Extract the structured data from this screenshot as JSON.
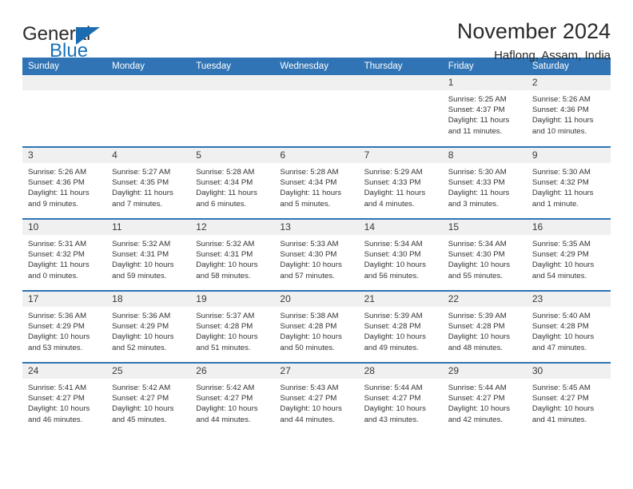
{
  "brand": {
    "name_top": "General",
    "name_bottom": "Blue",
    "color_blue": "#1b72b8",
    "triangle_icon": "triangle-icon"
  },
  "header": {
    "title": "November 2024",
    "subtitle": "Haflong, Assam, India",
    "header_bg": "#3074b5"
  },
  "calendar": {
    "weekday_headers": [
      "Sunday",
      "Monday",
      "Tuesday",
      "Wednesday",
      "Thursday",
      "Friday",
      "Saturday"
    ],
    "weeks": [
      [
        {
          "day": "",
          "blank": true,
          "sunrise": "",
          "sunset": "",
          "daylight1": "",
          "daylight2": ""
        },
        {
          "day": "",
          "blank": true,
          "sunrise": "",
          "sunset": "",
          "daylight1": "",
          "daylight2": ""
        },
        {
          "day": "",
          "blank": true,
          "sunrise": "",
          "sunset": "",
          "daylight1": "",
          "daylight2": ""
        },
        {
          "day": "",
          "blank": true,
          "sunrise": "",
          "sunset": "",
          "daylight1": "",
          "daylight2": ""
        },
        {
          "day": "",
          "blank": true,
          "sunrise": "",
          "sunset": "",
          "daylight1": "",
          "daylight2": ""
        },
        {
          "day": "1",
          "blank": false,
          "sunrise": "Sunrise: 5:25 AM",
          "sunset": "Sunset: 4:37 PM",
          "daylight1": "Daylight: 11 hours",
          "daylight2": "and 11 minutes."
        },
        {
          "day": "2",
          "blank": false,
          "sunrise": "Sunrise: 5:26 AM",
          "sunset": "Sunset: 4:36 PM",
          "daylight1": "Daylight: 11 hours",
          "daylight2": "and 10 minutes."
        }
      ],
      [
        {
          "day": "3",
          "blank": false,
          "sunrise": "Sunrise: 5:26 AM",
          "sunset": "Sunset: 4:36 PM",
          "daylight1": "Daylight: 11 hours",
          "daylight2": "and 9 minutes."
        },
        {
          "day": "4",
          "blank": false,
          "sunrise": "Sunrise: 5:27 AM",
          "sunset": "Sunset: 4:35 PM",
          "daylight1": "Daylight: 11 hours",
          "daylight2": "and 7 minutes."
        },
        {
          "day": "5",
          "blank": false,
          "sunrise": "Sunrise: 5:28 AM",
          "sunset": "Sunset: 4:34 PM",
          "daylight1": "Daylight: 11 hours",
          "daylight2": "and 6 minutes."
        },
        {
          "day": "6",
          "blank": false,
          "sunrise": "Sunrise: 5:28 AM",
          "sunset": "Sunset: 4:34 PM",
          "daylight1": "Daylight: 11 hours",
          "daylight2": "and 5 minutes."
        },
        {
          "day": "7",
          "blank": false,
          "sunrise": "Sunrise: 5:29 AM",
          "sunset": "Sunset: 4:33 PM",
          "daylight1": "Daylight: 11 hours",
          "daylight2": "and 4 minutes."
        },
        {
          "day": "8",
          "blank": false,
          "sunrise": "Sunrise: 5:30 AM",
          "sunset": "Sunset: 4:33 PM",
          "daylight1": "Daylight: 11 hours",
          "daylight2": "and 3 minutes."
        },
        {
          "day": "9",
          "blank": false,
          "sunrise": "Sunrise: 5:30 AM",
          "sunset": "Sunset: 4:32 PM",
          "daylight1": "Daylight: 11 hours",
          "daylight2": "and 1 minute."
        }
      ],
      [
        {
          "day": "10",
          "blank": false,
          "sunrise": "Sunrise: 5:31 AM",
          "sunset": "Sunset: 4:32 PM",
          "daylight1": "Daylight: 11 hours",
          "daylight2": "and 0 minutes."
        },
        {
          "day": "11",
          "blank": false,
          "sunrise": "Sunrise: 5:32 AM",
          "sunset": "Sunset: 4:31 PM",
          "daylight1": "Daylight: 10 hours",
          "daylight2": "and 59 minutes."
        },
        {
          "day": "12",
          "blank": false,
          "sunrise": "Sunrise: 5:32 AM",
          "sunset": "Sunset: 4:31 PM",
          "daylight1": "Daylight: 10 hours",
          "daylight2": "and 58 minutes."
        },
        {
          "day": "13",
          "blank": false,
          "sunrise": "Sunrise: 5:33 AM",
          "sunset": "Sunset: 4:30 PM",
          "daylight1": "Daylight: 10 hours",
          "daylight2": "and 57 minutes."
        },
        {
          "day": "14",
          "blank": false,
          "sunrise": "Sunrise: 5:34 AM",
          "sunset": "Sunset: 4:30 PM",
          "daylight1": "Daylight: 10 hours",
          "daylight2": "and 56 minutes."
        },
        {
          "day": "15",
          "blank": false,
          "sunrise": "Sunrise: 5:34 AM",
          "sunset": "Sunset: 4:30 PM",
          "daylight1": "Daylight: 10 hours",
          "daylight2": "and 55 minutes."
        },
        {
          "day": "16",
          "blank": false,
          "sunrise": "Sunrise: 5:35 AM",
          "sunset": "Sunset: 4:29 PM",
          "daylight1": "Daylight: 10 hours",
          "daylight2": "and 54 minutes."
        }
      ],
      [
        {
          "day": "17",
          "blank": false,
          "sunrise": "Sunrise: 5:36 AM",
          "sunset": "Sunset: 4:29 PM",
          "daylight1": "Daylight: 10 hours",
          "daylight2": "and 53 minutes."
        },
        {
          "day": "18",
          "blank": false,
          "sunrise": "Sunrise: 5:36 AM",
          "sunset": "Sunset: 4:29 PM",
          "daylight1": "Daylight: 10 hours",
          "daylight2": "and 52 minutes."
        },
        {
          "day": "19",
          "blank": false,
          "sunrise": "Sunrise: 5:37 AM",
          "sunset": "Sunset: 4:28 PM",
          "daylight1": "Daylight: 10 hours",
          "daylight2": "and 51 minutes."
        },
        {
          "day": "20",
          "blank": false,
          "sunrise": "Sunrise: 5:38 AM",
          "sunset": "Sunset: 4:28 PM",
          "daylight1": "Daylight: 10 hours",
          "daylight2": "and 50 minutes."
        },
        {
          "day": "21",
          "blank": false,
          "sunrise": "Sunrise: 5:39 AM",
          "sunset": "Sunset: 4:28 PM",
          "daylight1": "Daylight: 10 hours",
          "daylight2": "and 49 minutes."
        },
        {
          "day": "22",
          "blank": false,
          "sunrise": "Sunrise: 5:39 AM",
          "sunset": "Sunset: 4:28 PM",
          "daylight1": "Daylight: 10 hours",
          "daylight2": "and 48 minutes."
        },
        {
          "day": "23",
          "blank": false,
          "sunrise": "Sunrise: 5:40 AM",
          "sunset": "Sunset: 4:28 PM",
          "daylight1": "Daylight: 10 hours",
          "daylight2": "and 47 minutes."
        }
      ],
      [
        {
          "day": "24",
          "blank": false,
          "sunrise": "Sunrise: 5:41 AM",
          "sunset": "Sunset: 4:27 PM",
          "daylight1": "Daylight: 10 hours",
          "daylight2": "and 46 minutes."
        },
        {
          "day": "25",
          "blank": false,
          "sunrise": "Sunrise: 5:42 AM",
          "sunset": "Sunset: 4:27 PM",
          "daylight1": "Daylight: 10 hours",
          "daylight2": "and 45 minutes."
        },
        {
          "day": "26",
          "blank": false,
          "sunrise": "Sunrise: 5:42 AM",
          "sunset": "Sunset: 4:27 PM",
          "daylight1": "Daylight: 10 hours",
          "daylight2": "and 44 minutes."
        },
        {
          "day": "27",
          "blank": false,
          "sunrise": "Sunrise: 5:43 AM",
          "sunset": "Sunset: 4:27 PM",
          "daylight1": "Daylight: 10 hours",
          "daylight2": "and 44 minutes."
        },
        {
          "day": "28",
          "blank": false,
          "sunrise": "Sunrise: 5:44 AM",
          "sunset": "Sunset: 4:27 PM",
          "daylight1": "Daylight: 10 hours",
          "daylight2": "and 43 minutes."
        },
        {
          "day": "29",
          "blank": false,
          "sunrise": "Sunrise: 5:44 AM",
          "sunset": "Sunset: 4:27 PM",
          "daylight1": "Daylight: 10 hours",
          "daylight2": "and 42 minutes."
        },
        {
          "day": "30",
          "blank": false,
          "sunrise": "Sunrise: 5:45 AM",
          "sunset": "Sunset: 4:27 PM",
          "daylight1": "Daylight: 10 hours",
          "daylight2": "and 41 minutes."
        }
      ]
    ]
  }
}
